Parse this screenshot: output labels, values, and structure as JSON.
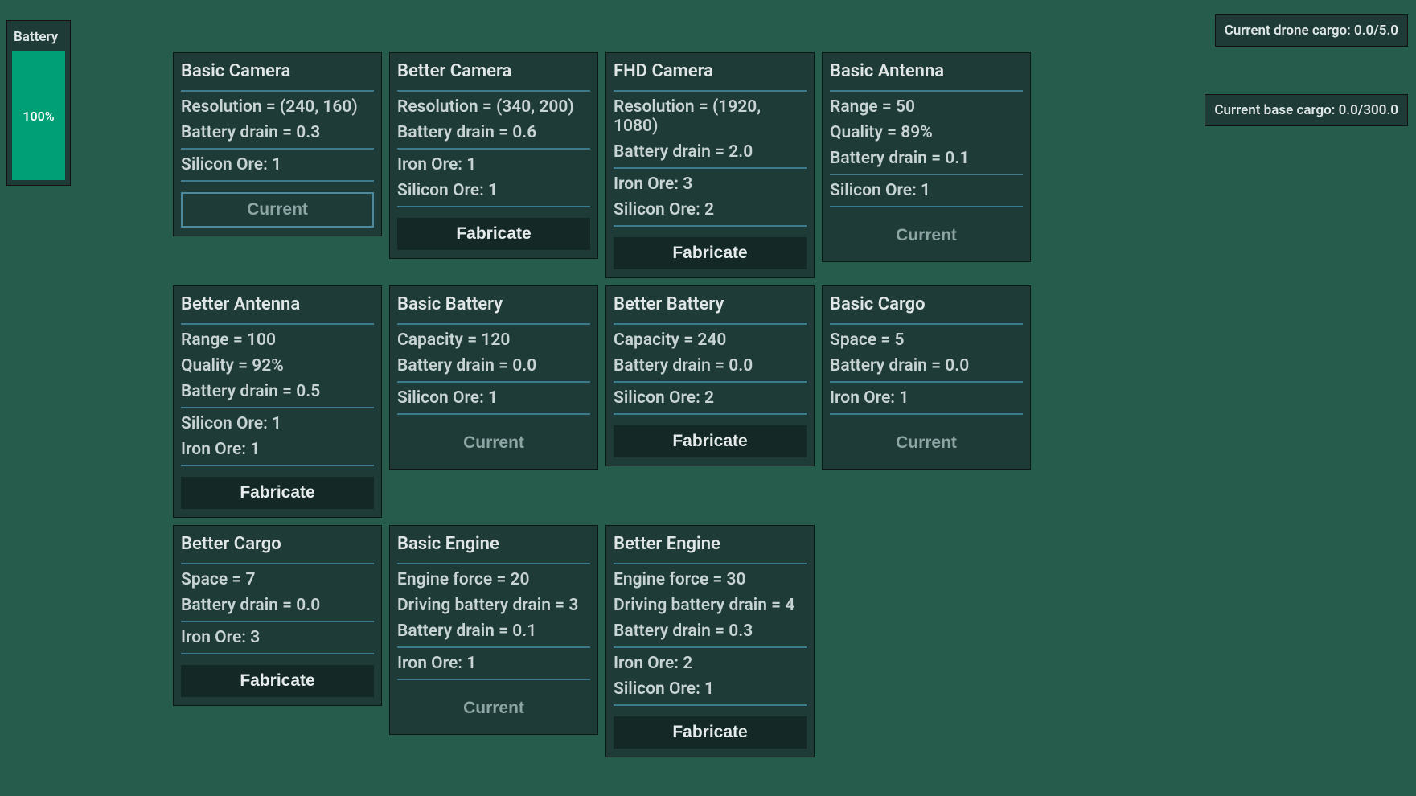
{
  "battery": {
    "label": "Battery",
    "percent": "100%"
  },
  "status": {
    "drone_cargo": "Current drone cargo: 0.0/5.0",
    "base_cargo": "Current base cargo: 0.0/300.0"
  },
  "buttons": {
    "fabricate": "Fabricate",
    "current": "Current"
  },
  "cards": [
    {
      "title": "Basic Camera",
      "stats": [
        "Resolution = (240, 160)",
        "Battery drain = 0.3"
      ],
      "costs": [
        "Silicon Ore: 1"
      ],
      "state": "current_outlined"
    },
    {
      "title": "Better Camera",
      "stats": [
        "Resolution = (340, 200)",
        "Battery drain = 0.6"
      ],
      "costs": [
        "Iron Ore: 1",
        "Silicon Ore: 1"
      ],
      "state": "fabricate"
    },
    {
      "title": "FHD Camera",
      "stats": [
        "Resolution = (1920, 1080)",
        "Battery drain = 2.0"
      ],
      "costs": [
        "Iron Ore: 3",
        "Silicon Ore: 2"
      ],
      "state": "fabricate"
    },
    {
      "title": "Basic Antenna",
      "stats": [
        "Range = 50",
        "Quality = 89%",
        "Battery drain = 0.1"
      ],
      "costs": [
        "Silicon Ore: 1"
      ],
      "state": "current_plain"
    },
    {
      "title": "Better Antenna",
      "stats": [
        "Range = 100",
        "Quality = 92%",
        "Battery drain = 0.5"
      ],
      "costs": [
        "Silicon Ore: 1",
        "Iron Ore: 1"
      ],
      "state": "fabricate"
    },
    {
      "title": "Basic Battery",
      "stats": [
        "Capacity = 120",
        "Battery drain = 0.0"
      ],
      "costs": [
        "Silicon Ore: 1"
      ],
      "state": "current_plain"
    },
    {
      "title": "Better Battery",
      "stats": [
        "Capacity = 240",
        "Battery drain = 0.0"
      ],
      "costs": [
        "Silicon Ore: 2"
      ],
      "state": "fabricate"
    },
    {
      "title": "Basic Cargo",
      "stats": [
        "Space = 5",
        "Battery drain = 0.0"
      ],
      "costs": [
        "Iron Ore: 1"
      ],
      "state": "current_plain"
    },
    {
      "title": "Better Cargo",
      "stats": [
        "Space = 7",
        "Battery drain = 0.0"
      ],
      "costs": [
        "Iron Ore: 3"
      ],
      "state": "fabricate"
    },
    {
      "title": "Basic Engine",
      "stats": [
        "Engine force = 20",
        "Driving battery drain = 3",
        "Battery drain = 0.1"
      ],
      "costs": [
        "Iron Ore: 1"
      ],
      "state": "current_plain"
    },
    {
      "title": "Better Engine",
      "stats": [
        "Engine force = 30",
        "Driving battery drain = 4",
        "Battery drain = 0.3"
      ],
      "costs": [
        "Iron Ore: 2",
        "Silicon Ore: 1"
      ],
      "state": "fabricate"
    }
  ]
}
